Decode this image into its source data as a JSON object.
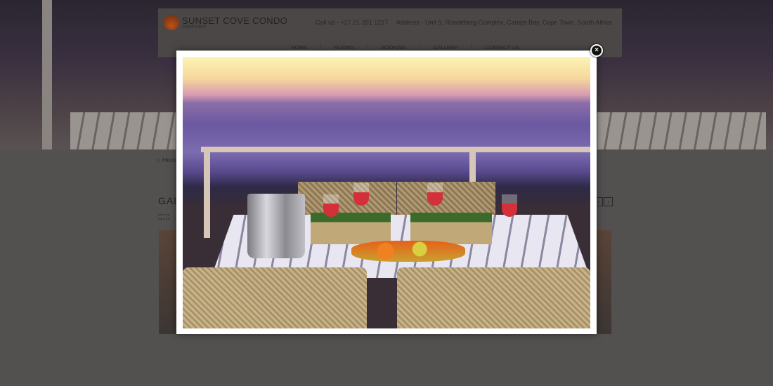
{
  "header": {
    "logo_title": "SUNSET COVE CONDO",
    "logo_subtitle": "CAMPS BAY",
    "phone": "Call us - +27 21 201 1217",
    "address": "Address - Unit 9, Roodeberg Complex, Camps Bay, Cape Town, South Africa",
    "nav": [
      "HOME",
      "ROOMS",
      "BOOKING",
      "GALLERY",
      "CONTACT US"
    ]
  },
  "breadcrumb": {
    "icon": "home-icon",
    "label": "Home"
  },
  "gallery": {
    "title": "GALLERY",
    "prev": "‹",
    "next": "›"
  },
  "lightbox": {
    "close_label": "×",
    "image_alt": "Sunset dinner table on balcony overlooking Camps Bay"
  },
  "colors": {
    "overlay": "#535050",
    "lightbox_border": "#ffffff",
    "close_button": "#111111"
  }
}
